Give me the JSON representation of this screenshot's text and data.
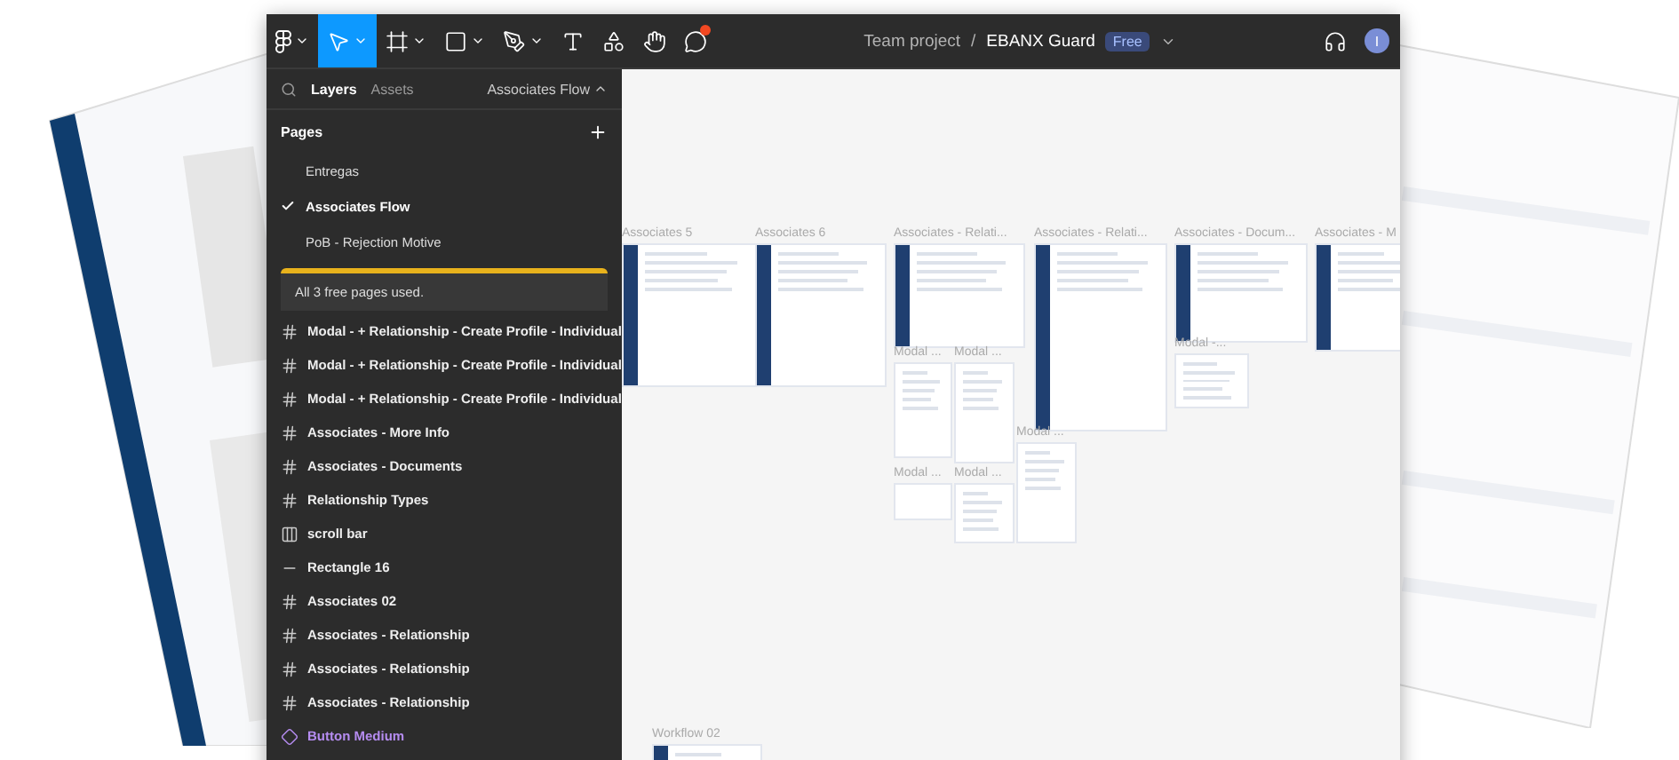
{
  "toolbar": {
    "tools": [
      {
        "kind": "main-menu",
        "selected": false,
        "caret": true
      },
      {
        "kind": "move",
        "selected": true,
        "caret": true
      },
      {
        "kind": "frame",
        "selected": false,
        "caret": true
      },
      {
        "kind": "rectangle",
        "selected": false,
        "caret": true
      },
      {
        "kind": "pen",
        "selected": false,
        "caret": true
      },
      {
        "kind": "text",
        "selected": false,
        "caret": false
      },
      {
        "kind": "resources",
        "selected": false,
        "caret": false
      },
      {
        "kind": "hand",
        "selected": false,
        "caret": false
      },
      {
        "kind": "comment",
        "selected": false,
        "caret": false,
        "notification": true
      }
    ],
    "breadcrumb": {
      "team": "Team project",
      "separator": "/",
      "file": "EBANX Guard",
      "plan": "Free"
    },
    "avatar": "I"
  },
  "panel": {
    "tabs": [
      {
        "label": "Layers",
        "selected": true
      },
      {
        "label": "Assets",
        "selected": false
      }
    ],
    "current_page": "Associates Flow",
    "pages_title": "Pages",
    "pages": [
      {
        "label": "Entregas",
        "selected": false
      },
      {
        "label": "Associates Flow",
        "selected": true
      },
      {
        "label": "PoB - Rejection Motive",
        "selected": false
      }
    ],
    "notice": "All 3 free pages used.",
    "layers": [
      {
        "kind": "frame",
        "label": "Modal - + Relationship - Create Profile - Individual"
      },
      {
        "kind": "frame",
        "label": "Modal - + Relationship - Create Profile - Individual"
      },
      {
        "kind": "frame",
        "label": "Modal - + Relationship - Create Profile - Individual"
      },
      {
        "kind": "frame",
        "label": "Associates - More Info"
      },
      {
        "kind": "frame",
        "label": "Associates - Documents"
      },
      {
        "kind": "frame",
        "label": "Relationship Types"
      },
      {
        "kind": "auto-layout",
        "label": "scroll bar"
      },
      {
        "kind": "line",
        "label": "Rectangle 16"
      },
      {
        "kind": "frame",
        "label": "Associates 02"
      },
      {
        "kind": "frame",
        "label": "Associates - Relationship"
      },
      {
        "kind": "frame",
        "label": "Associates - Relationship"
      },
      {
        "kind": "frame",
        "label": "Associates - Relationship"
      },
      {
        "kind": "component",
        "label": "Button Medium"
      }
    ]
  },
  "canvas": {
    "frames": [
      {
        "kind": "page",
        "label": "Associates 5"
      },
      {
        "kind": "page",
        "label": "Associates 6"
      },
      {
        "kind": "page",
        "label": "Associates  - Relati..."
      },
      {
        "kind": "page",
        "label": "Associates  - Relati..."
      },
      {
        "kind": "page",
        "label": "Associates - Docum..."
      },
      {
        "kind": "page",
        "label": "Associates - M"
      },
      {
        "kind": "modal",
        "label": "Modal ..."
      },
      {
        "kind": "modal",
        "label": "Modal ..."
      },
      {
        "kind": "modal",
        "label": "Modal ..."
      },
      {
        "kind": "modal",
        "label": "Modal -..."
      },
      {
        "kind": "modal",
        "label": "Modal ..."
      },
      {
        "kind": "modal",
        "label": "Modal ..."
      },
      {
        "kind": "page",
        "label": "Workflow 02"
      }
    ]
  }
}
